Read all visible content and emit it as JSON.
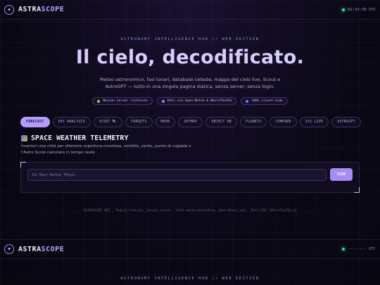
{
  "header": {
    "brand_prefix": "ASTRA",
    "brand_suffix": "SCOPE",
    "clock": "02:42:39 UTC"
  },
  "header2": {
    "brand_prefix": "ASTRA",
    "brand_suffix": "SCOPE",
    "clock": "--:--:-- UTC"
  },
  "hero": {
    "kicker": "ASTRONOMY INTELLIGENCE HUB // WEB EDITION",
    "title": "Il cielo, decodificato.",
    "subtitle": "Meteo astronomico, fasi lunari, database celeste, mappa del cielo live, Scout e AstroGPT — tutto in una singola pagina statica, senza server, senza login.",
    "pills": [
      {
        "label": "Nessun server richiesto",
        "color": "#8fd16a"
      },
      {
        "label": "Dati via Open-Meteo & WhereTheISS",
        "color": "#c46bff"
      },
      {
        "label": "100% client-side",
        "color": "#4e8cff"
      }
    ]
  },
  "tabs": [
    {
      "label": "FORECAST",
      "active": true
    },
    {
      "label": "SKY ANALYSIS",
      "active": false
    },
    {
      "label": "SCOUT 🔍",
      "active": false
    },
    {
      "label": "TARGETS",
      "active": false
    },
    {
      "label": "MOON",
      "active": false
    },
    {
      "label": "SKYMAP",
      "active": false
    },
    {
      "label": "OBJECT DB",
      "active": false
    },
    {
      "label": "PLANETS",
      "active": false
    },
    {
      "label": "COMPARE",
      "active": false
    },
    {
      "label": "ISS LIVE",
      "active": false
    },
    {
      "label": "ASTROGPT",
      "active": false
    }
  ],
  "section": {
    "title": "SPACE WEATHER TELEMETRY",
    "icon": "space-weather-icon",
    "subtitle": "Inserisci una città per ottenere copertura nuvolosa, umidità, vento, punto di rugiada e l'Astro Score calcolato in tempo reale."
  },
  "search": {
    "placeholder": "Es. Bari, Roma, Tokyo...",
    "value": "",
    "button_label": "SCAN"
  },
  "footer": {
    "text": "ASTRASCOPE WEB · Pagina statica, nessun server · Dati meteo/geocoding: Open-Meteo.com · Dati ISS: WhereTheISS.at"
  },
  "kicker2": "ASTRONOMY INTELLIGENCE HUB // WEB EDITION"
}
